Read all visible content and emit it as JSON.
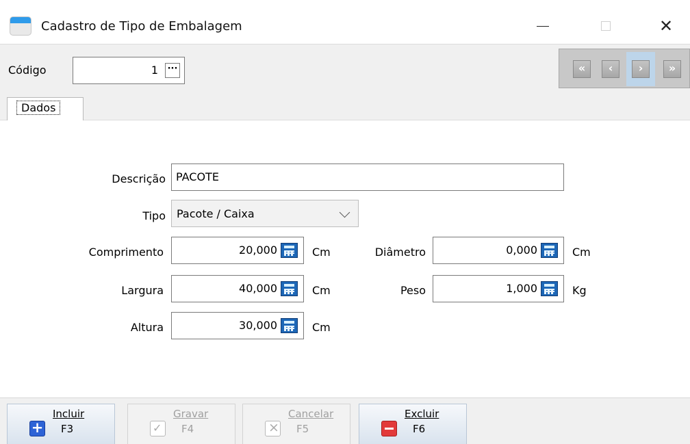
{
  "window": {
    "title": "Cadastro de Tipo de Embalagem",
    "minimize_glyph": "—",
    "close_glyph": "✕"
  },
  "toolbar": {
    "code_label": "Código",
    "code_value": "1",
    "lookup_glyph": "···",
    "nav": {
      "first": "«",
      "prev": "‹",
      "next": "›",
      "last": "»"
    }
  },
  "tabs": [
    {
      "label": "Dados",
      "selected": true
    }
  ],
  "form": {
    "descricao": {
      "label": "Descrição",
      "value": "PACOTE"
    },
    "tipo": {
      "label": "Tipo",
      "value": "Pacote / Caixa"
    },
    "comprimento": {
      "label": "Comprimento",
      "value": "20,000",
      "unit": "Cm"
    },
    "largura": {
      "label": "Largura",
      "value": "40,000",
      "unit": "Cm"
    },
    "altura": {
      "label": "Altura",
      "value": "30,000",
      "unit": "Cm"
    },
    "diametro": {
      "label": "Diâmetro",
      "value": "0,000",
      "unit": "Cm"
    },
    "peso": {
      "label": "Peso",
      "value": "1,000",
      "unit": "Kg"
    }
  },
  "actions": [
    {
      "label": "Incluir",
      "key": "F3",
      "icon": "add-icon",
      "enabled": true
    },
    {
      "label": "Gravar",
      "key": "F4",
      "icon": "check-icon",
      "enabled": false
    },
    {
      "label": "Cancelar",
      "key": "F5",
      "icon": "cancel-icon",
      "enabled": false
    },
    {
      "label": "Excluir",
      "key": "F6",
      "icon": "delete-icon",
      "enabled": true
    }
  ],
  "colors": {
    "accent": "#1d67b7",
    "add": "#2d63d6",
    "delete": "#e23a3a",
    "nav_highlight": "#bdd5ea"
  }
}
